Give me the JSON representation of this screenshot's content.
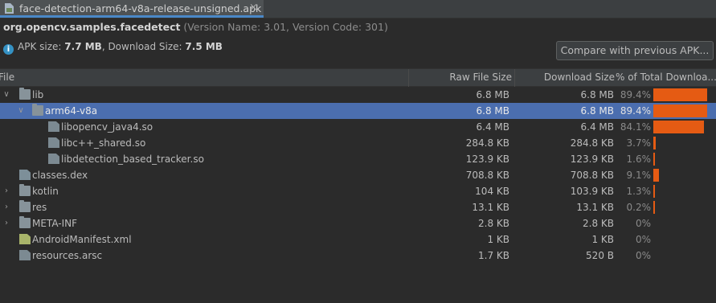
{
  "tab": {
    "title": "face-detection-arm64-v8a-release-unsigned.apk",
    "close": "×"
  },
  "package": {
    "name": "org.opencv.samples.facedetect",
    "version_info": "(Version Name: 3.01, Version Code: 301)"
  },
  "sizes": {
    "apk_label": "APK size:",
    "apk_size": "7.7 MB",
    "download_label": ", Download Size:",
    "download_size": "7.5 MB"
  },
  "compare_button": "Compare with previous APK...",
  "columns": {
    "file": "File",
    "raw": "Raw File Size",
    "download": "Download Size",
    "pct": "% of Total Downloa..."
  },
  "accent_color": "#e55b13",
  "selection_color": "#4b6eaf",
  "rows": [
    {
      "name": "lib",
      "raw": "6.8 MB",
      "dl": "6.8 MB",
      "pct": "89.4%",
      "fraction": 0.894,
      "icon": "folder-icon",
      "expander": "expanded"
    },
    {
      "name": "arm64-v8a",
      "raw": "6.8 MB",
      "dl": "6.8 MB",
      "pct": "89.4%",
      "fraction": 0.894,
      "icon": "folder-icon",
      "expander": "expanded",
      "selected": true
    },
    {
      "name": "libopencv_java4.so",
      "raw": "6.4 MB",
      "dl": "6.4 MB",
      "pct": "84.1%",
      "fraction": 0.841,
      "icon": "unknown-file-icon",
      "expander": "none"
    },
    {
      "name": "libc++_shared.so",
      "raw": "284.8 KB",
      "dl": "284.8 KB",
      "pct": "3.7%",
      "fraction": 0.037,
      "icon": "unknown-file-icon",
      "expander": "none"
    },
    {
      "name": "libdetection_based_tracker.so",
      "raw": "123.9 KB",
      "dl": "123.9 KB",
      "pct": "1.6%",
      "fraction": 0.016,
      "icon": "unknown-file-icon",
      "expander": "none"
    },
    {
      "name": "classes.dex",
      "raw": "708.8 KB",
      "dl": "708.8 KB",
      "pct": "9.1%",
      "fraction": 0.091,
      "icon": "dex-file-icon",
      "expander": "none"
    },
    {
      "name": "kotlin",
      "raw": "104 KB",
      "dl": "103.9 KB",
      "pct": "1.3%",
      "fraction": 0.013,
      "icon": "folder-icon",
      "expander": "collapsed"
    },
    {
      "name": "res",
      "raw": "13.1 KB",
      "dl": "13.1 KB",
      "pct": "0.2%",
      "fraction": 0.002,
      "icon": "folder-icon",
      "expander": "collapsed"
    },
    {
      "name": "META-INF",
      "raw": "2.8 KB",
      "dl": "2.8 KB",
      "pct": "0%",
      "fraction": 0,
      "icon": "folder-icon",
      "expander": "collapsed"
    },
    {
      "name": "AndroidManifest.xml",
      "raw": "1 KB",
      "dl": "1 KB",
      "pct": "0%",
      "fraction": 0,
      "icon": "manifest-file-icon",
      "expander": "none"
    },
    {
      "name": "resources.arsc",
      "raw": "1.7 KB",
      "dl": "520 B",
      "pct": "0%",
      "fraction": 0,
      "icon": "arsc-file-icon",
      "expander": "none"
    }
  ]
}
